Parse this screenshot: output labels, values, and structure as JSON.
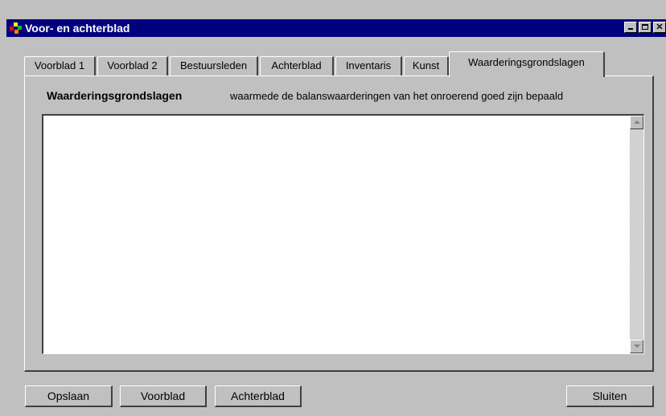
{
  "window": {
    "title": "Voor- en achterblad",
    "icon": "app-icon",
    "controls": [
      "minimize",
      "maximize",
      "close"
    ]
  },
  "tabs": [
    {
      "label": "Voorblad 1"
    },
    {
      "label": "Voorblad 2"
    },
    {
      "label": "Bestuursleden"
    },
    {
      "label": "Achterblad"
    },
    {
      "label": "Inventaris"
    },
    {
      "label": "Kunst"
    },
    {
      "label": "Waarderingsgrondslagen",
      "active": true
    }
  ],
  "panel": {
    "title": "Waarderingsgrondslagen",
    "description": "waarmede de balanswaarderingen van het onroerend goed zijn bepaald",
    "text": ""
  },
  "buttons": {
    "save": "Opslaan",
    "front": "Voorblad",
    "back": "Achterblad",
    "close": "Sluiten"
  },
  "colors": {
    "titlebar": "#00007f",
    "face": "#c0c0c0"
  }
}
